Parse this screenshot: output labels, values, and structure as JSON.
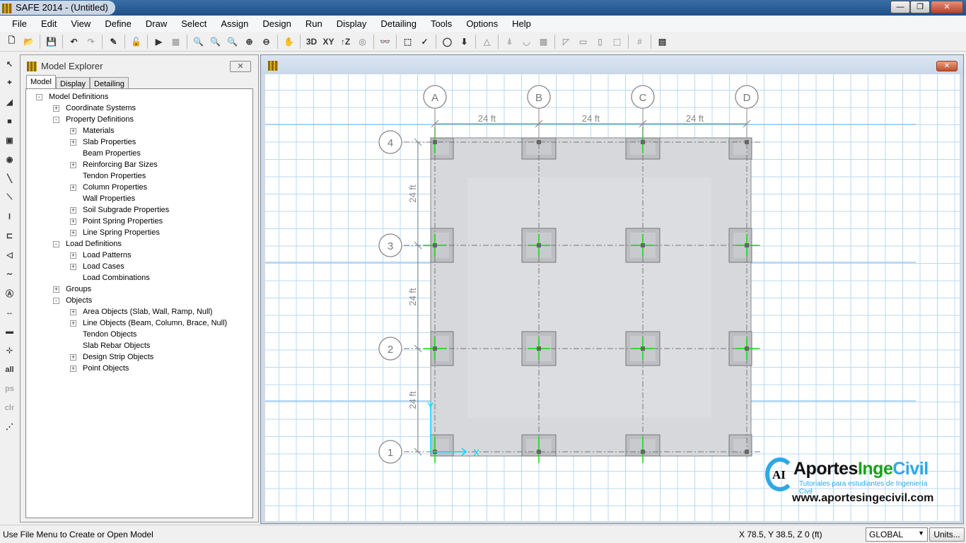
{
  "window": {
    "title": "SAFE 2014 - (Untitled)",
    "minimize": "—",
    "maximize": "❐",
    "close": "✕"
  },
  "menu": [
    "File",
    "Edit",
    "View",
    "Define",
    "Draw",
    "Select",
    "Assign",
    "Design",
    "Run",
    "Display",
    "Detailing",
    "Tools",
    "Options",
    "Help"
  ],
  "toolbar": [
    {
      "icon": "new-file-icon",
      "g": "🗋"
    },
    {
      "icon": "open-folder-icon",
      "g": "📂"
    },
    {
      "sep": true
    },
    {
      "icon": "save-icon",
      "g": "💾"
    },
    {
      "sep": true
    },
    {
      "icon": "undo-icon",
      "g": "↶"
    },
    {
      "icon": "redo-icon",
      "g": "↷",
      "dim": true
    },
    {
      "sep": true
    },
    {
      "icon": "pencil-icon",
      "g": "✎"
    },
    {
      "sep": true
    },
    {
      "icon": "lock-icon",
      "g": "🔓"
    },
    {
      "sep": true
    },
    {
      "icon": "run-icon",
      "g": "▶"
    },
    {
      "icon": "run-design-icon",
      "g": "▦",
      "dim": true
    },
    {
      "sep": true
    },
    {
      "icon": "zoom-window-icon",
      "g": "🔍"
    },
    {
      "icon": "zoom-full-icon",
      "g": "🔍"
    },
    {
      "icon": "zoom-previous-icon",
      "g": "🔍"
    },
    {
      "icon": "zoom-in-icon",
      "g": "⊕"
    },
    {
      "icon": "zoom-out-icon",
      "g": "⊖"
    },
    {
      "sep": true
    },
    {
      "icon": "pan-icon",
      "g": "✋"
    },
    {
      "sep": true
    },
    {
      "icon": "view-3d-icon",
      "g": "3D"
    },
    {
      "icon": "view-xy-icon",
      "g": "XY"
    },
    {
      "icon": "view-z-icon",
      "g": "↑Z"
    },
    {
      "icon": "rotate-icon",
      "g": "◎",
      "dim": true
    },
    {
      "sep": true
    },
    {
      "icon": "glasses-icon",
      "g": "👓"
    },
    {
      "sep": true
    },
    {
      "icon": "select-icon",
      "g": "⬚"
    },
    {
      "icon": "check-icon",
      "g": "✓"
    },
    {
      "sep": true
    },
    {
      "icon": "circle-icon",
      "g": "◯"
    },
    {
      "icon": "assign-load-icon",
      "g": "⬇"
    },
    {
      "sep": true
    },
    {
      "icon": "triangle-icon",
      "g": "△",
      "dim": true
    },
    {
      "sep": true
    },
    {
      "icon": "support-icon",
      "g": "⍋",
      "dim": true
    },
    {
      "icon": "deformed-icon",
      "g": "◡",
      "dim": true
    },
    {
      "icon": "contour-icon",
      "g": "▩",
      "dim": true
    },
    {
      "sep": true
    },
    {
      "icon": "strip-icon",
      "g": "◸",
      "dim": true
    },
    {
      "icon": "beam-icon",
      "g": "▭",
      "dim": true
    },
    {
      "icon": "column-icon",
      "g": "▯",
      "dim": true
    },
    {
      "icon": "punching-icon",
      "g": "⬚",
      "dim": true
    },
    {
      "sep": true
    },
    {
      "icon": "grid-icon",
      "g": "#",
      "dim": true
    },
    {
      "sep": true
    },
    {
      "icon": "table-icon",
      "g": "▤"
    }
  ],
  "left_toolbar": [
    {
      "icon": "pointer-icon",
      "g": "↖"
    },
    {
      "icon": "reshape-icon",
      "g": "⌖"
    },
    {
      "icon": "draw-area-icon",
      "g": "◢"
    },
    {
      "icon": "draw-rectangle-icon",
      "g": "■"
    },
    {
      "icon": "draw-point-icon",
      "g": "▣"
    },
    {
      "icon": "draw-circle-icon",
      "g": "◉"
    },
    {
      "icon": "draw-line-icon",
      "g": "╲"
    },
    {
      "icon": "draw-line-region-icon",
      "g": "⟍"
    },
    {
      "icon": "draw-column-icon",
      "g": "Ⅰ"
    },
    {
      "icon": "draw-beam-icon",
      "g": "⊏"
    },
    {
      "icon": "draw-wall-icon",
      "g": "◁"
    },
    {
      "icon": "draw-tendon-icon",
      "g": "∼"
    },
    {
      "icon": "draw-grid-icon",
      "g": "Ⓐ"
    },
    {
      "icon": "dimension-icon",
      "g": "↔"
    },
    {
      "icon": "strip-icon",
      "g": "▬"
    },
    {
      "icon": "snap-icon",
      "g": "⊹"
    },
    {
      "text": "all"
    },
    {
      "text": "ps",
      "dim": true
    },
    {
      "text": "clr",
      "dim": true
    },
    {
      "icon": "deselect-icon",
      "g": "⋰"
    }
  ],
  "explorer": {
    "title": "Model Explorer",
    "close": "✕",
    "tabs": [
      "Model",
      "Display",
      "Detailing"
    ],
    "tree": [
      {
        "l": 0,
        "t": "Model Definitions",
        "pm": "-"
      },
      {
        "l": 1,
        "t": "Coordinate Systems",
        "pm": "+"
      },
      {
        "l": 1,
        "t": "Property Definitions",
        "pm": "-"
      },
      {
        "l": 2,
        "t": "Materials",
        "pm": "+"
      },
      {
        "l": 2,
        "t": "Slab Properties",
        "pm": "+"
      },
      {
        "l": 2,
        "t": "Beam Properties"
      },
      {
        "l": 2,
        "t": "Reinforcing Bar Sizes",
        "pm": "+"
      },
      {
        "l": 2,
        "t": "Tendon Properties"
      },
      {
        "l": 2,
        "t": "Column Properties",
        "pm": "+"
      },
      {
        "l": 2,
        "t": "Wall Properties"
      },
      {
        "l": 2,
        "t": "Soil Subgrade Properties",
        "pm": "+"
      },
      {
        "l": 2,
        "t": "Point Spring Properties",
        "pm": "+"
      },
      {
        "l": 2,
        "t": "Line Spring Properties",
        "pm": "+"
      },
      {
        "l": 1,
        "t": "Load Definitions",
        "pm": "-"
      },
      {
        "l": 2,
        "t": "Load Patterns",
        "pm": "+"
      },
      {
        "l": 2,
        "t": "Load Cases",
        "pm": "+"
      },
      {
        "l": 2,
        "t": "Load Combinations"
      },
      {
        "l": 1,
        "t": "Groups",
        "pm": "+"
      },
      {
        "l": 1,
        "t": "Objects",
        "pm": "-"
      },
      {
        "l": 2,
        "t": "Area Objects (Slab, Wall, Ramp, Null)",
        "pm": "+"
      },
      {
        "l": 2,
        "t": "Line Objects (Beam, Column, Brace, Null)",
        "pm": "+"
      },
      {
        "l": 2,
        "t": "Tendon Objects"
      },
      {
        "l": 2,
        "t": "Slab Rebar Objects"
      },
      {
        "l": 2,
        "t": "Design Strip Objects",
        "pm": "+"
      },
      {
        "l": 2,
        "t": "Point Objects",
        "pm": "+"
      }
    ]
  },
  "canvas": {
    "close": "✕",
    "grid_x": [
      "A",
      "B",
      "C",
      "D"
    ],
    "grid_y": [
      "4",
      "3",
      "2",
      "1"
    ],
    "spacing_x": [
      "24 ft",
      "24 ft",
      "24 ft"
    ],
    "spacing_y": [
      "24 ft",
      "24 ft",
      "24 ft"
    ],
    "axis_x": "X",
    "axis_y": "Y",
    "colors": {
      "grid": "#b8daf5",
      "grid_major": "#8ec4ee",
      "slab": "#d6d8dc",
      "column": "#bcbec2",
      "column_line": "#00e000",
      "axis": "#00d8ff"
    }
  },
  "logo": {
    "brand_a": "Aportes",
    "brand_b": "Inge",
    "brand_c": "Civil",
    "mark": "AI",
    "subtitle": "Tutoriales para estudiantes de Ingeniería Civil",
    "url": "www.aportesingecivil.com"
  },
  "status": {
    "message": "Use File Menu to Create or Open Model",
    "coords": "X 78.5,  Y 38.5,  Z 0  (ft)",
    "coord_system": "GLOBAL",
    "units_button": "Units..."
  }
}
